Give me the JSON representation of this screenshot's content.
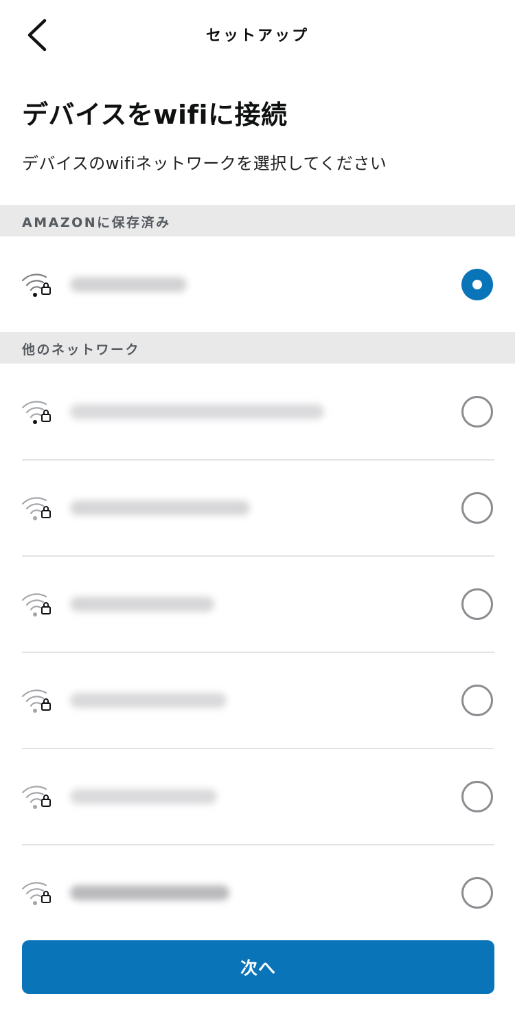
{
  "header": {
    "back_icon": "chevron-left-icon",
    "title": "セットアップ"
  },
  "page": {
    "title": "デバイスをwifiに接続",
    "subtitle": "デバイスのwifiネットワークを選択してください"
  },
  "sections": {
    "saved": {
      "label": "AMAZONに保存済み"
    },
    "other": {
      "label": "他のネットワーク"
    }
  },
  "networks": {
    "icon": "wifi-lock-icon",
    "saved": [
      {
        "ssid": "",
        "selected": true
      }
    ],
    "other": [
      {
        "ssid": "",
        "selected": false
      },
      {
        "ssid": "",
        "selected": false
      },
      {
        "ssid": "",
        "selected": false
      },
      {
        "ssid": "",
        "selected": false
      },
      {
        "ssid": "",
        "selected": false
      },
      {
        "ssid": "",
        "selected": false
      }
    ]
  },
  "footer": {
    "next_label": "次へ"
  },
  "colors": {
    "accent": "#0a74b9",
    "section_bg": "#e9e9ea",
    "radio_off": "#8a8d91"
  }
}
